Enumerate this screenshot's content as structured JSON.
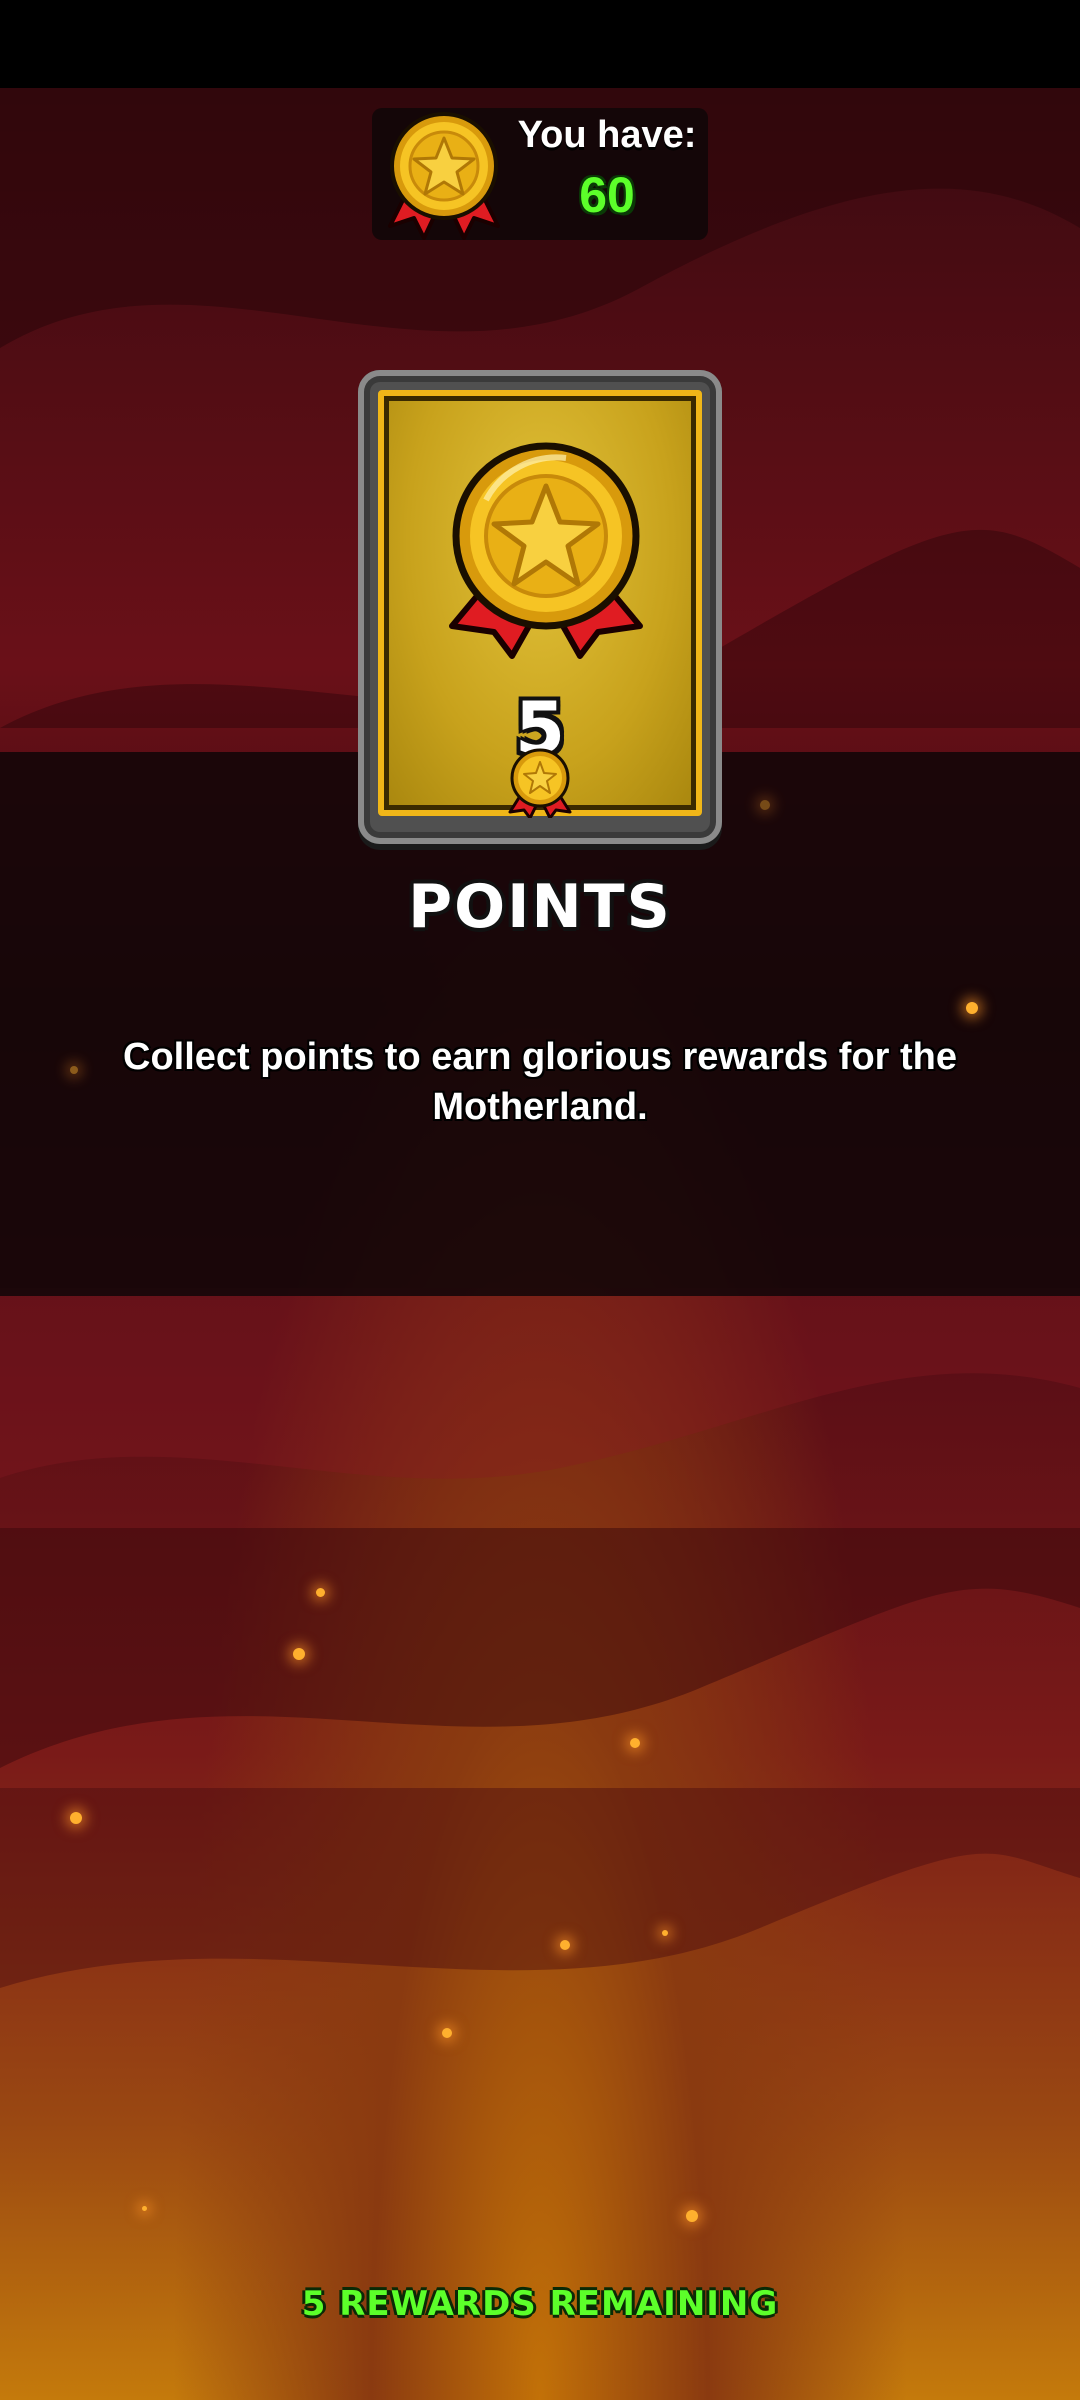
{
  "balance": {
    "label": "You have:",
    "value": "60",
    "icon": "medal-icon"
  },
  "reward_card": {
    "icon": "medal-icon",
    "amount": "5",
    "badge_icon": "medal-badge-icon"
  },
  "reward": {
    "title": "POINTS",
    "description": "Collect points to earn glorious rewards for the Motherland."
  },
  "footer": {
    "remaining": "5 REWARDS REMAINING"
  },
  "colors": {
    "accent_green": "#5cff2a",
    "gold": "#f0b618",
    "ribbon_red": "#e01c22"
  }
}
